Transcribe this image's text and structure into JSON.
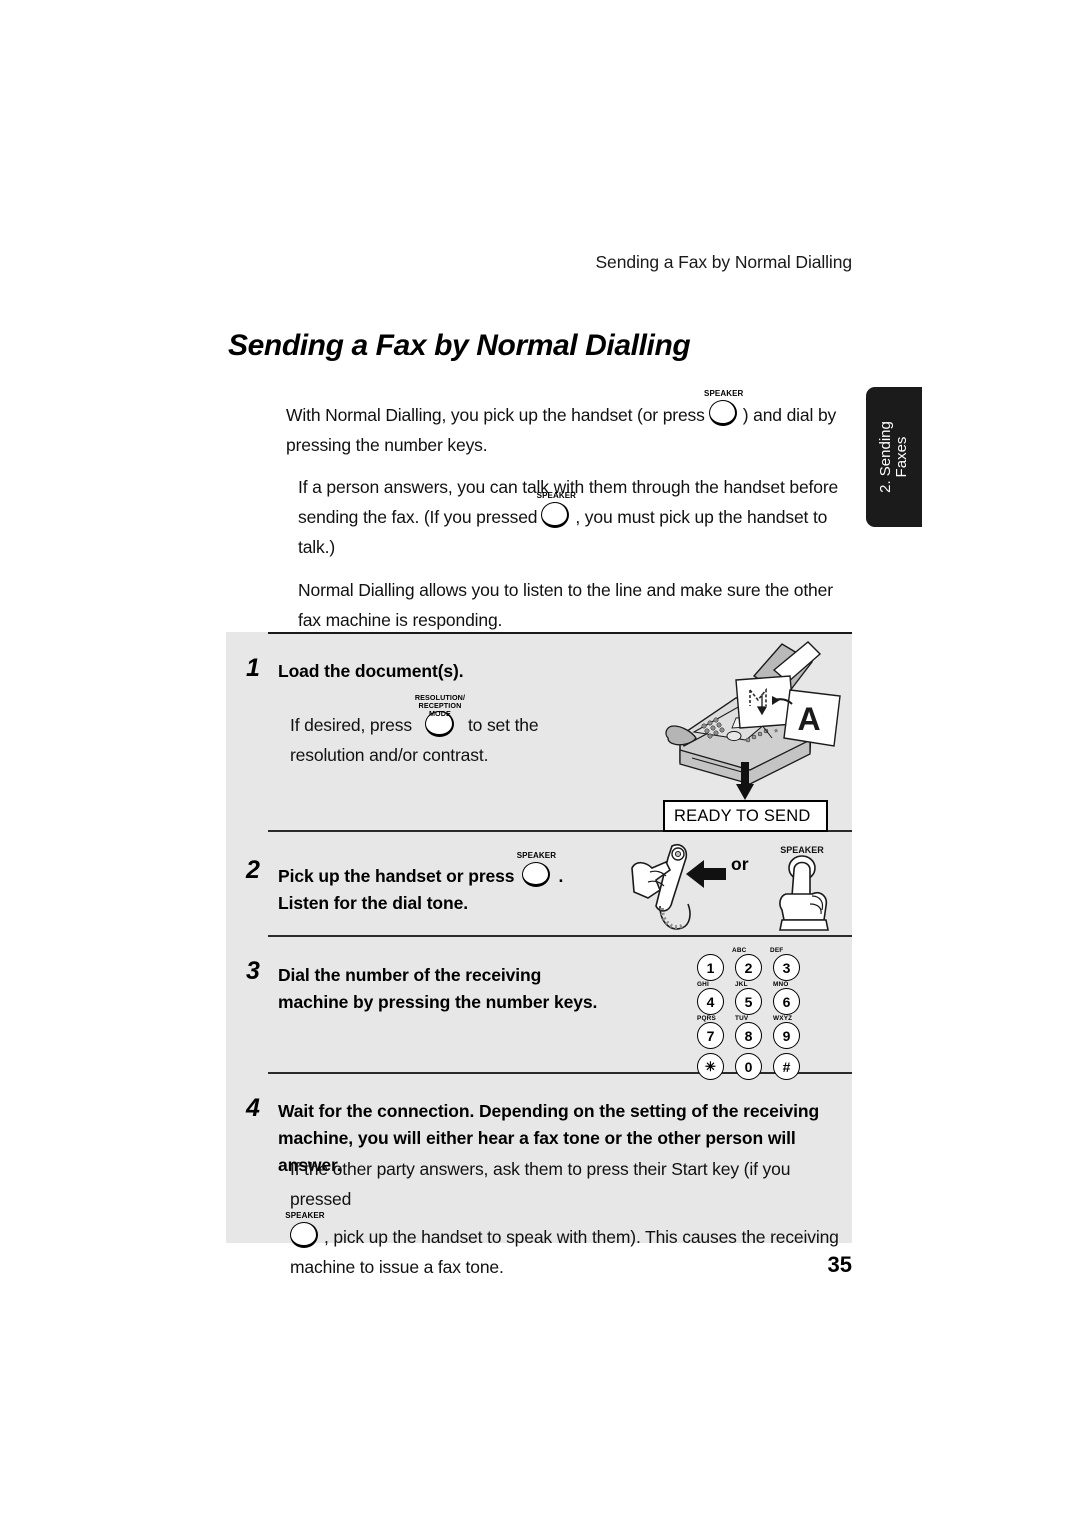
{
  "page": {
    "running_header": "Sending a Fax by Normal Dialling",
    "section_title": "Sending a Fax by Normal Dialling",
    "page_number": "35",
    "box_gray": "#e7e7e7",
    "tab_color": "#1b1b1b"
  },
  "thumb_tab": {
    "label": "2. Sending\nFaxes"
  },
  "intro": {
    "p1_before": "With Normal Dialling, you pick up the handset (or press",
    "p1_key": "SPEAKER",
    "p1_after": ") and dial by pressing the number keys.",
    "p2_before": "If a person answers, you can talk with them through the handset before sending the fax. (If you pressed",
    "p2_key": "SPEAKER",
    "p2_after": ", you must pick up the handset to talk.)",
    "p3": "Normal Dialling allows you to listen to the line and make sure the other fax machine is responding."
  },
  "steps": [
    {
      "number": "1",
      "heading": "Load the document(s).",
      "body_before": "If desired, press",
      "body_key": "RESOLUTION/\nRECEPTION MODE",
      "body_after": "to set the resolution and/or contrast.",
      "display_text": "READY TO SEND",
      "art": "fax-machine"
    },
    {
      "number": "2",
      "heading_line1_before": "Pick up the handset or press",
      "heading_key": "SPEAKER",
      "heading_line1_after": ".",
      "heading_line2": "Listen for the dial tone.",
      "or_label": "or",
      "press_key_label": "SPEAKER",
      "art": "handset-and-finger"
    },
    {
      "number": "3",
      "heading_line1": "Dial the number of the receiving",
      "heading_line2": "machine by pressing the number keys.",
      "art": "keypad"
    },
    {
      "number": "4",
      "heading_line1": "Wait for the connection. Depending on the setting of the receiving",
      "heading_line2": "machine, you will either hear a fax tone or the other person will answer.",
      "body_before": "If the other party answers, ask them to press their Start key (if you pressed",
      "body_key": "SPEAKER",
      "body_after": ", pick up the handset to speak with them). This causes the receiving machine to issue a fax tone."
    }
  ],
  "keypad": {
    "keys": [
      {
        "digit": "1",
        "letters": ""
      },
      {
        "digit": "2",
        "letters": "ABC"
      },
      {
        "digit": "3",
        "letters": "DEF"
      },
      {
        "digit": "4",
        "letters": "GHI"
      },
      {
        "digit": "5",
        "letters": "JKL"
      },
      {
        "digit": "6",
        "letters": "MNO"
      },
      {
        "digit": "7",
        "letters": "PQRS"
      },
      {
        "digit": "8",
        "letters": "TUV"
      },
      {
        "digit": "9",
        "letters": "WXYZ"
      },
      {
        "digit": "✳",
        "letters": ""
      },
      {
        "digit": "0",
        "letters": ""
      },
      {
        "digit": "#",
        "letters": ""
      }
    ]
  }
}
